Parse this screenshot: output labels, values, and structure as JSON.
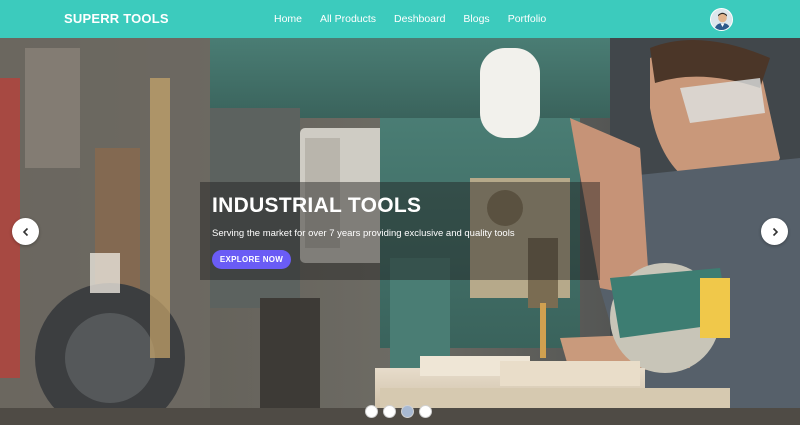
{
  "navbar": {
    "brand": "SUPERR TOOLS",
    "links": [
      "Home",
      "All Products",
      "Deshboard",
      "Blogs",
      "Portfolio"
    ],
    "avatar_icon": "user-avatar-icon"
  },
  "hero": {
    "title": "INDUSTRIAL TOOLS",
    "subtitle": "Serving the market for over 7 years providing exclusive and quality tools",
    "cta_label": "EXPLORE NOW",
    "prev_icon": "chevron-left-icon",
    "next_icon": "chevron-right-icon",
    "slides_count": 4,
    "active_slide": 3
  },
  "colors": {
    "navbar": "#3ccbbd",
    "cta": "#6a5cf5",
    "active_dot": "#a8b9d2"
  }
}
